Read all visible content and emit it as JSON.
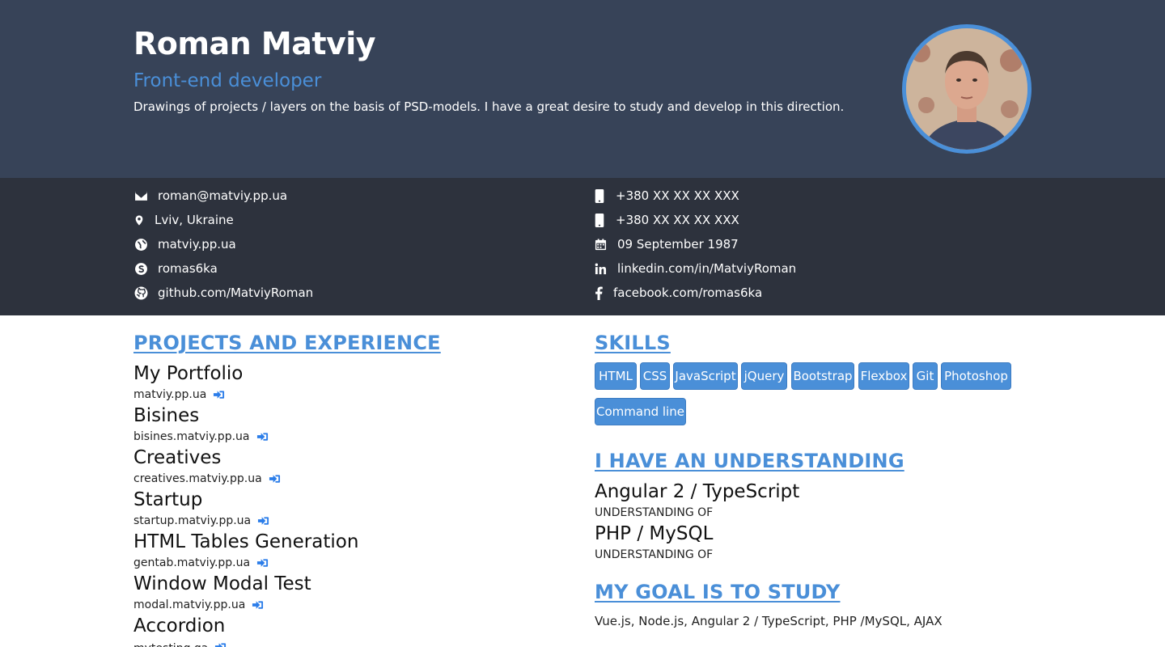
{
  "header": {
    "name": "Roman Matviy",
    "role": "Front-end developer",
    "description": "Drawings of projects / layers on the basis of PSD-models. I have a great desire to study and develop in this direction."
  },
  "contacts": {
    "left": [
      {
        "icon": "envelope-icon",
        "text": "roman@matviy.pp.ua"
      },
      {
        "icon": "map-marker-icon",
        "text": "Lviv, Ukraine"
      },
      {
        "icon": "globe-icon",
        "text": "matviy.pp.ua"
      },
      {
        "icon": "skype-icon",
        "text": "romas6ka"
      },
      {
        "icon": "github-icon",
        "text": "github.com/MatviyRoman"
      }
    ],
    "right": [
      {
        "icon": "mobile-phone-icon",
        "text": "+380 XX XX XX XXX"
      },
      {
        "icon": "mobile-phone-icon",
        "text": "+380 XX XX XX XXX"
      },
      {
        "icon": "calendar-icon",
        "text": "09 September 1987"
      },
      {
        "icon": "linkedin-icon",
        "text": "linkedin.com/in/MatviyRoman"
      },
      {
        "icon": "facebook-icon",
        "text": "facebook.com/romas6ka"
      }
    ]
  },
  "projects": {
    "heading": "PROJECTS AND EXPERIENCE",
    "items": [
      {
        "title": "My Portfolio",
        "url": "matviy.pp.ua"
      },
      {
        "title": "Bisines",
        "url": "bisines.matviy.pp.ua"
      },
      {
        "title": "Creatives",
        "url": "creatives.matviy.pp.ua"
      },
      {
        "title": "Startup",
        "url": "startup.matviy.pp.ua"
      },
      {
        "title": "HTML Tables Generation",
        "url": "gentab.matviy.pp.ua"
      },
      {
        "title": "Window Modal Test",
        "url": "modal.matviy.pp.ua"
      },
      {
        "title": "Accordion",
        "url": "mytesting.ga"
      }
    ]
  },
  "skills": {
    "heading": "SKILLS",
    "items": [
      "HTML",
      "CSS",
      "JavaScript",
      "jQuery",
      "Bootstrap",
      "Flexbox",
      "Git",
      "Photoshop",
      "Command line"
    ]
  },
  "understanding": {
    "heading": "I HAVE AN UNDERSTANDING",
    "items": [
      {
        "title": "Angular 2 / TypeScript",
        "note": "UNDERSTANDING OF"
      },
      {
        "title": "PHP / MySQL",
        "note": "UNDERSTANDING OF"
      }
    ]
  },
  "goal": {
    "heading": "MY GOAL IS TO STUDY",
    "text": "Vue.js, Node.js, Angular 2 / TypeScript, PHP /MySQL, AJAX"
  },
  "colors": {
    "header_bg": "#374358",
    "contacts_bg": "#2d323d",
    "accent": "#4a8fd8",
    "link_icon": "#2b7de9"
  }
}
